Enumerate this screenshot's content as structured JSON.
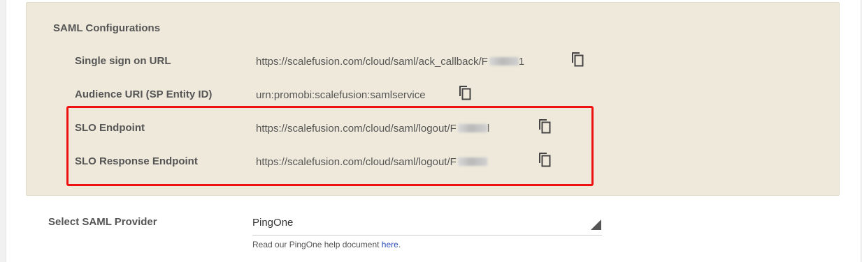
{
  "saml": {
    "title": "SAML Configurations",
    "rows": [
      {
        "label": "Single sign on URL",
        "value": "https://scalefusion.com/cloud/saml/ack_callback/F"
      },
      {
        "label": "Audience URI (SP Entity ID)",
        "value": "urn:promobi:scalefusion:samlservice"
      },
      {
        "label": "SLO Endpoint",
        "value": "https://scalefusion.com/cloud/saml/logout/F"
      },
      {
        "label": "SLO Response Endpoint",
        "value": "https://scalefusion.com/cloud/saml/logout/F"
      }
    ]
  },
  "provider": {
    "label": "Select SAML Provider",
    "selected": "PingOne",
    "help_prefix": "Read our PingOne help document ",
    "help_link": "here",
    "help_suffix": "."
  },
  "colors": {
    "panel_background": "#efe9db",
    "highlight_border": "#ee1111",
    "link": "#2a4bbb"
  },
  "icons": {
    "copy": "copy-icon",
    "dropdown": "dropdown-arrow-icon"
  }
}
